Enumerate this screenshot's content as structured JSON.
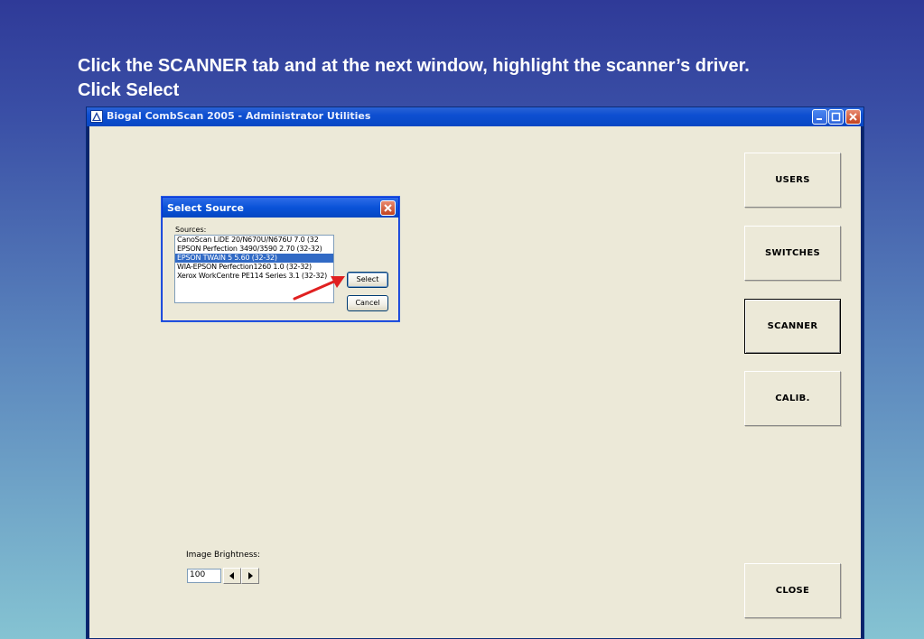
{
  "slide": {
    "title_line1": "Click the SCANNER tab and at the next window,  highlight the scanner’s driver.",
    "title_line2": "Click Select"
  },
  "app": {
    "title": "Biogal CombScan 2005 - Administrator Utilities",
    "nav_buttons": [
      {
        "label": "USERS"
      },
      {
        "label": "SWITCHES"
      },
      {
        "label": "SCANNER",
        "active": true
      },
      {
        "label": "CALIB."
      },
      {
        "label": "CLOSE"
      }
    ],
    "brightness": {
      "label": "Image Brightness:",
      "value": "100"
    }
  },
  "dialog": {
    "title": "Select Source",
    "sources_label": "Sources:",
    "sources": [
      "CanoScan LiDE 20/N670U/N676U 7.0 (32",
      "EPSON Perfection 3490/3590 2.70 (32-32)",
      "EPSON TWAIN 5 5.60 (32-32)",
      "WIA-EPSON Perfection1260 1.0 (32-32)",
      "Xerox WorkCentre PE114 Series 3.1 (32-32)"
    ],
    "selected_index": 2,
    "select_label": "Select",
    "cancel_label": "Cancel"
  },
  "colors": {
    "arrow": "#e02020",
    "selection": "#316ac5"
  }
}
